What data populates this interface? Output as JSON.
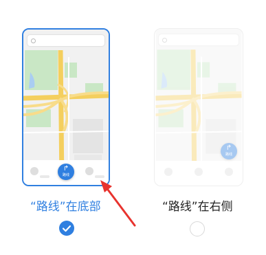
{
  "options": [
    {
      "caption": "“路线”在底部",
      "route_button_label": "路线",
      "selected": true
    },
    {
      "caption": "“路线”在右侧",
      "route_button_label": "路线",
      "selected": false
    }
  ],
  "colors": {
    "accent": "#2f7fe0",
    "annotation_arrow": "#e8332e",
    "map_green": "#c9e7c5",
    "map_road": "#f4cf5e",
    "map_water": "#a9cdf2"
  },
  "icons": {
    "route": "route-arrow-icon",
    "search": "search-icon",
    "selected": "checkmark-icon"
  }
}
